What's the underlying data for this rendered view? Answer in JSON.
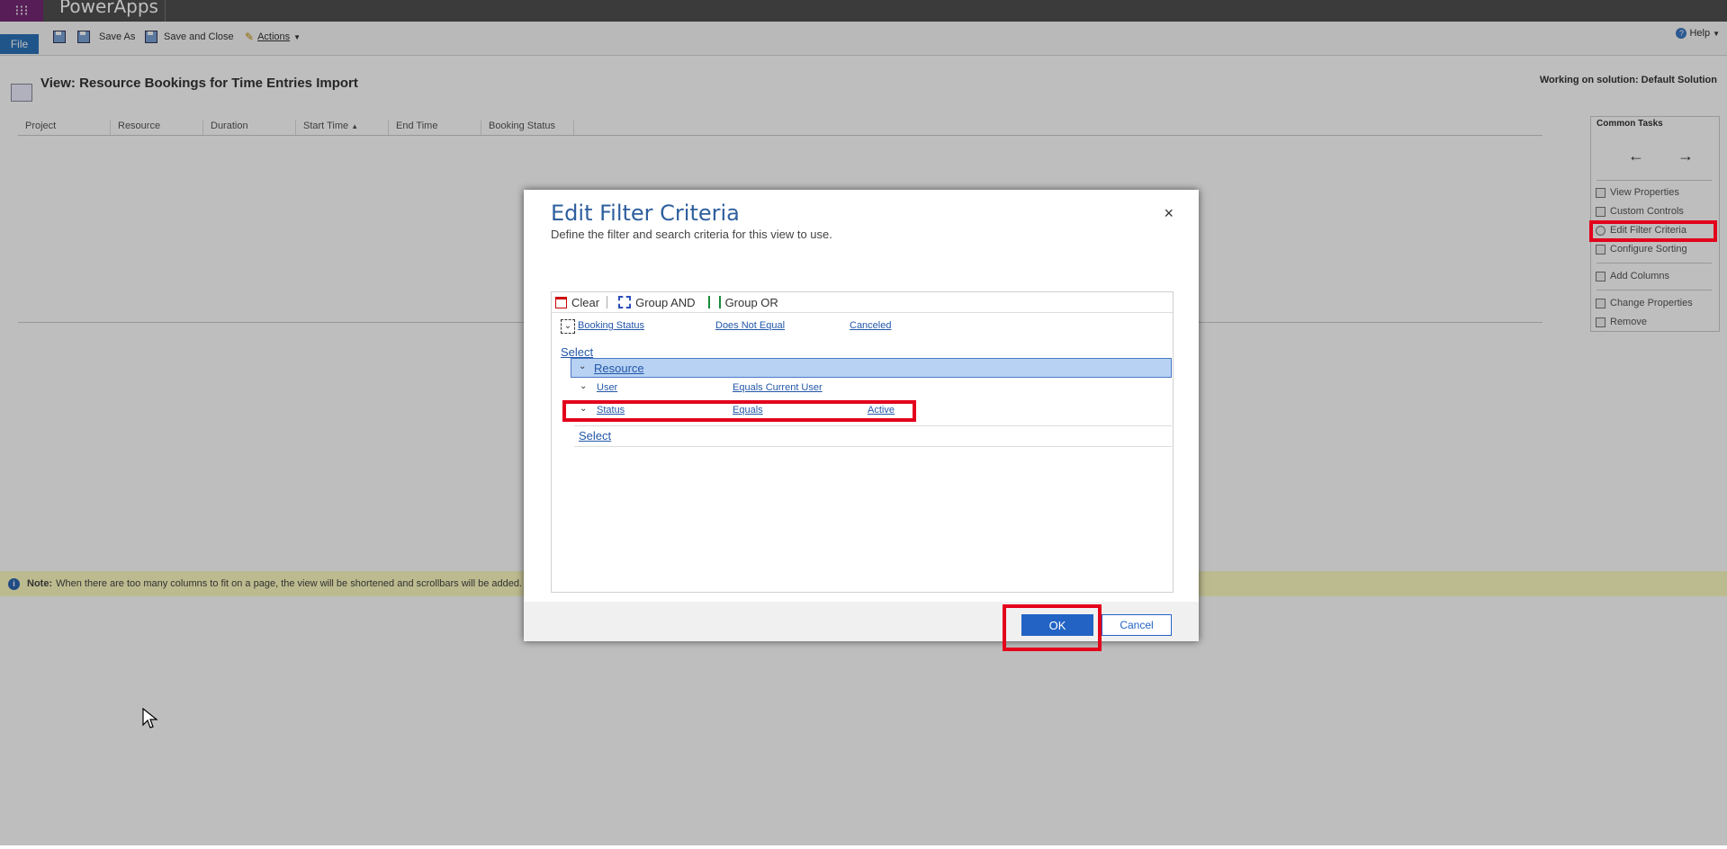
{
  "app": {
    "name": "PowerApps"
  },
  "ribbon": {
    "file": "File",
    "save_as": "Save As",
    "save_and_close": "Save and Close",
    "actions": "Actions",
    "help": "Help"
  },
  "page": {
    "title": "View: Resource Bookings for Time Entries Import",
    "solution": "Working on solution: Default Solution"
  },
  "grid": {
    "columns": [
      "Project",
      "Resource",
      "Duration",
      "Start Time",
      "End Time",
      "Booking Status"
    ],
    "sort_indicator": "▲"
  },
  "common_tasks": {
    "title": "Common Tasks",
    "back": "←",
    "forward": "→",
    "items": [
      "View Properties",
      "Custom Controls",
      "Edit Filter Criteria",
      "Configure Sorting",
      "Add Columns",
      "Change Properties",
      "Remove"
    ]
  },
  "note": {
    "label": "Note:",
    "text": "When there are too many columns to fit on a page, the view will be shortened and scrollbars will be added."
  },
  "dialog": {
    "title": "Edit Filter Criteria",
    "subtitle": "Define the filter and search criteria for this view to use.",
    "close": "×",
    "toolbar": {
      "clear": "Clear",
      "group_and": "Group AND",
      "group_or": "Group OR"
    },
    "row1": {
      "field": "Booking Status",
      "operator": "Does Not Equal",
      "value": "Canceled"
    },
    "select1": "Select",
    "group": {
      "entity": "Resource"
    },
    "row2": {
      "field": "User",
      "operator": "Equals Current User"
    },
    "row3": {
      "field": "Status",
      "operator": "Equals",
      "value": "Active"
    },
    "select2": "Select",
    "ok": "OK",
    "cancel": "Cancel"
  },
  "colors": {
    "accent": "#2263c4",
    "highlight": "#e3001b",
    "note_bg": "#fdfbc0",
    "app_purple": "#742774"
  }
}
